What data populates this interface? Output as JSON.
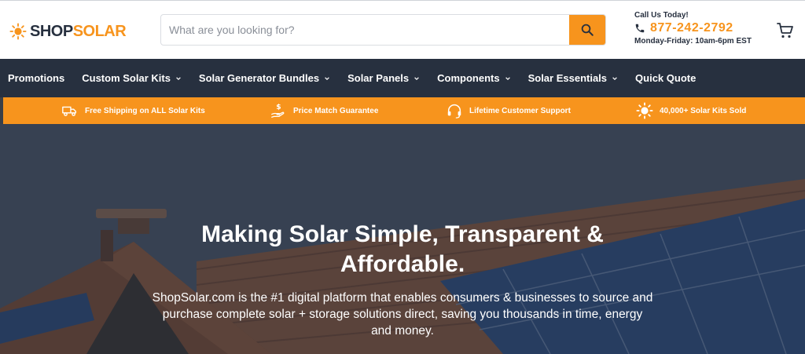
{
  "brand": {
    "logo_part1": "SHOP",
    "logo_part2": "SOLAR",
    "accent_color": "#f7941d",
    "dark_color": "#27303f"
  },
  "search": {
    "placeholder": "What are you looking for?",
    "button_icon": "search-icon"
  },
  "contact": {
    "call_label": "Call Us Today!",
    "phone": "877-242-2792",
    "hours": "Monday-Friday: 10am-6pm EST",
    "phone_icon": "phone-icon"
  },
  "cart": {
    "icon": "cart-icon"
  },
  "nav": {
    "items": [
      {
        "label": "Promotions",
        "has_dropdown": false
      },
      {
        "label": "Custom Solar Kits",
        "has_dropdown": true
      },
      {
        "label": "Solar Generator Bundles",
        "has_dropdown": true
      },
      {
        "label": "Solar Panels",
        "has_dropdown": true
      },
      {
        "label": "Components",
        "has_dropdown": true
      },
      {
        "label": "Solar Essentials",
        "has_dropdown": true
      },
      {
        "label": "Quick Quote",
        "has_dropdown": false
      }
    ]
  },
  "benefits": [
    {
      "icon": "truck-icon",
      "label": "Free Shipping on ALL Solar Kits"
    },
    {
      "icon": "price-hand-icon",
      "label": "Price Match Guarantee"
    },
    {
      "icon": "headset-icon",
      "label": "Lifetime Customer Support"
    },
    {
      "icon": "sun-icon",
      "label": "40,000+ Solar Kits Sold"
    }
  ],
  "hero": {
    "title": "Making Solar Simple, Transparent & Affordable.",
    "text": "ShopSolar.com is the #1 digital platform that enables consumers & businesses to source and purchase complete solar + storage solutions direct, saving you thousands in time, energy and money."
  }
}
